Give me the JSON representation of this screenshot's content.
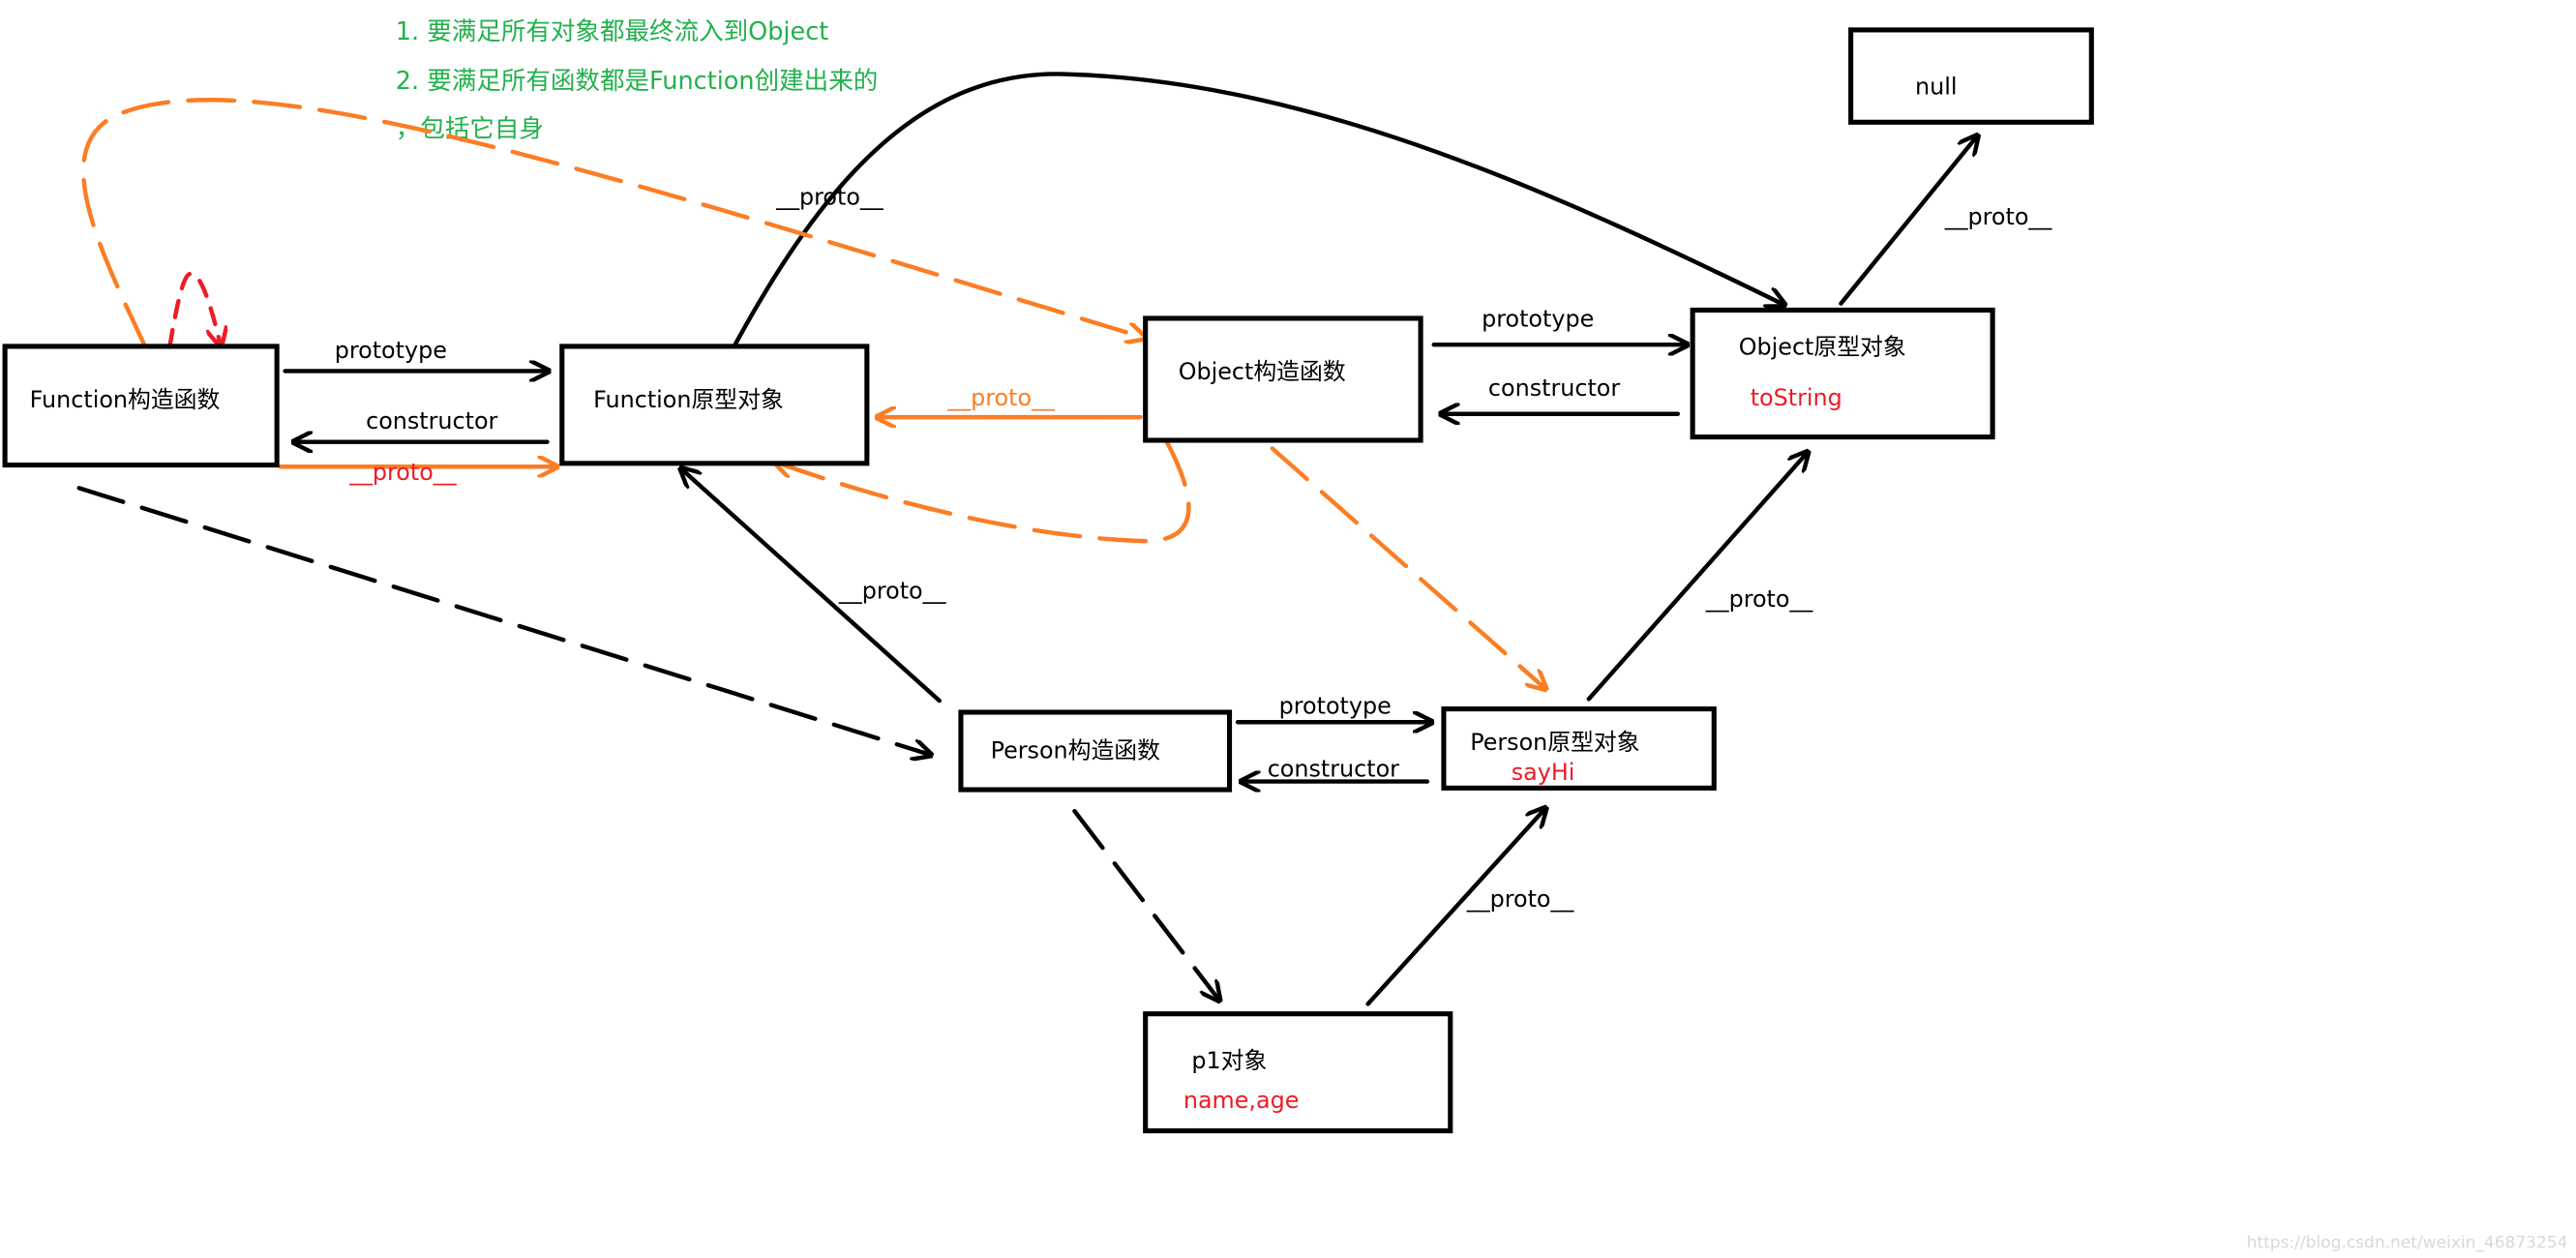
{
  "notes": [
    "1. 要满足所有对象都最终流入到Object",
    "2. 要满足所有函数都是Function创建出来的",
    "，包括它自身"
  ],
  "nodes": {
    "function_ctor": {
      "label": "Function构造函数"
    },
    "function_proto": {
      "label": "Function原型对象"
    },
    "object_ctor": {
      "label": "Object构造函数"
    },
    "object_proto": {
      "label": "Object原型对象",
      "member": "toString"
    },
    "null_node": {
      "label": "null"
    },
    "person_ctor": {
      "label": "Person构造函数"
    },
    "person_proto": {
      "label": "Person原型对象",
      "member": "sayHi"
    },
    "p1": {
      "label": "p1对象",
      "member": "name,age"
    }
  },
  "edges": {
    "fctor_prototype": "prototype",
    "fproto_constructor": "constructor",
    "fctor_proto": "__proto__",
    "fproto_proto": "__proto__",
    "octor_proto": "__proto__",
    "octor_prototype": "prototype",
    "oproto_constructor": "constructor",
    "oproto_proto": "__proto__",
    "pproto_proto": "__proto__",
    "pctor_proto": "__proto__",
    "pctor_prototype": "prototype",
    "pproto_constructor": "constructor",
    "p1_proto": "__proto__"
  },
  "colors": {
    "note": "#22b14c",
    "member": "#ed1c24",
    "orange": "#fb7d24",
    "red": "#ed1c24"
  },
  "watermark": "https://blog.csdn.net/weixin_46873254"
}
